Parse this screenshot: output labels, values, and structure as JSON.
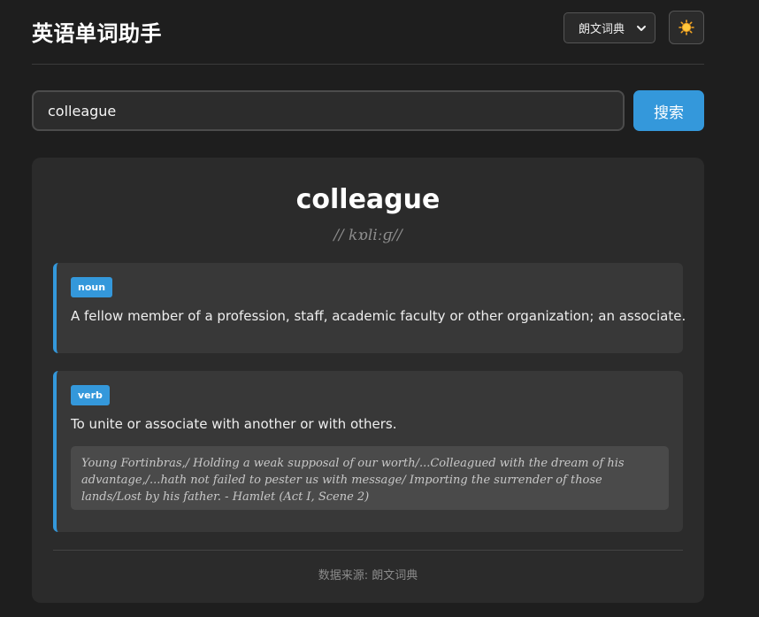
{
  "header": {
    "app_title": "英语单词助手",
    "dict_select": {
      "selected": "朗文词典"
    },
    "theme_toggle_icon": "sun-icon"
  },
  "search": {
    "value": "colleague",
    "button_label": "搜索"
  },
  "result": {
    "word": "colleague",
    "phonetic": "// kɒliːɡ//",
    "meanings": [
      {
        "pos": "noun",
        "definition": "A fellow member of a profession, staff, academic faculty or other organization; an associate."
      },
      {
        "pos": "verb",
        "definition": "To unite or associate with another or with others.",
        "example": "Young Fortinbras,/ Holding a weak supposal of our worth/...Colleagued with the dream of his advantage,/...hath not failed to pester us with message/ Importing the surrender of those lands/Lost by his father. - Hamlet (Act I, Scene 2)"
      }
    ],
    "source_label": "数据来源:",
    "source_value": "朗文词典"
  },
  "colors": {
    "accent": "#3498db",
    "background": "#1e1e1e",
    "card": "#2b2b2b",
    "meaning_card": "#383838"
  }
}
